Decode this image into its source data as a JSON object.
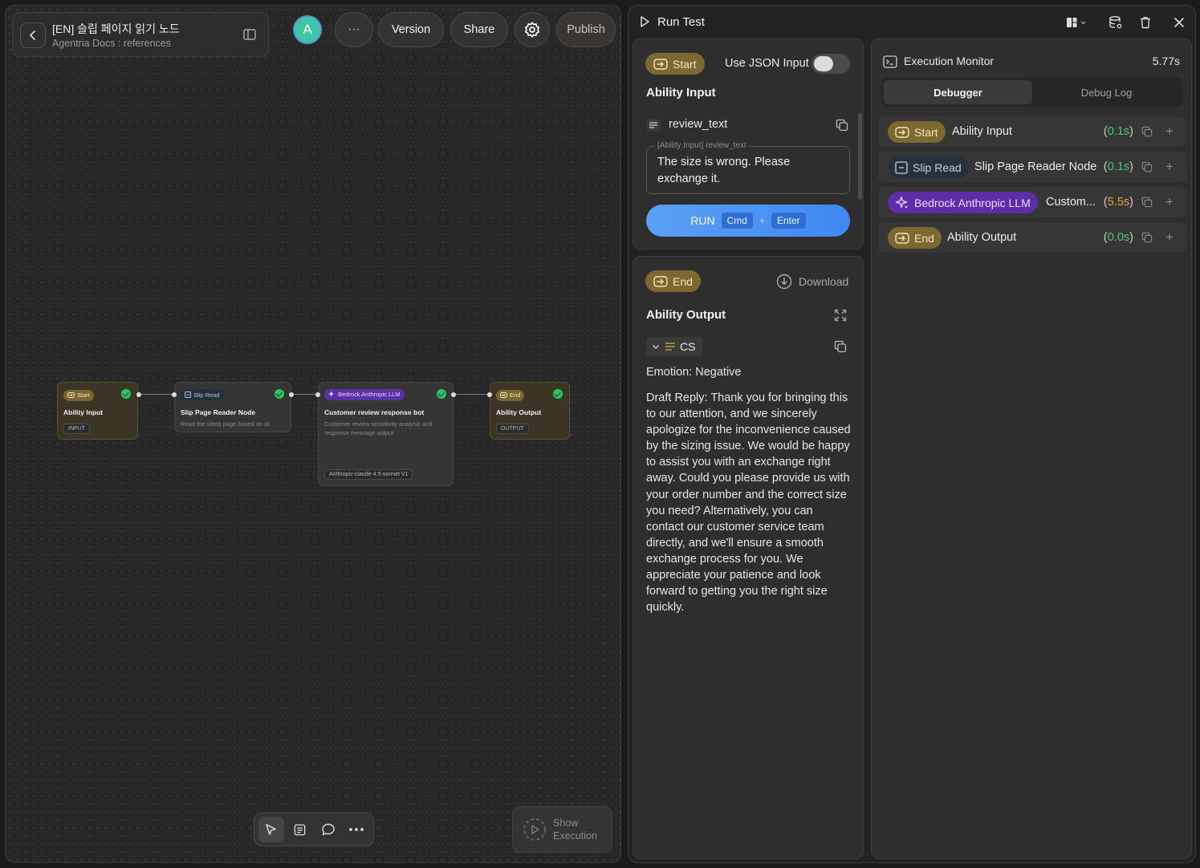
{
  "header": {
    "doc_title": "[EN] 슬립 페이지 읽기 노드",
    "doc_subtitle": "Agentria Docs : references",
    "avatar_letter": "A",
    "more_label": "···",
    "version_label": "Version",
    "share_label": "Share",
    "publish_label": "Publish"
  },
  "canvas": {
    "nodes": [
      {
        "badge": "Start",
        "title": "Ability Input",
        "tag": "INPUT"
      },
      {
        "badge": "Slip Read",
        "title": "Slip Page Reader Node",
        "desc": "Read the sleep page based on id"
      },
      {
        "badge": "Bedrock Anthropic LLM",
        "title": "Customer review response bot",
        "desc": "Customer review sensitivity analysis and response message output",
        "tag": "Anthropic-claude-4.5-sonnet V1"
      },
      {
        "badge": "End",
        "title": "Ability Output",
        "tag": "OUTPUT"
      }
    ],
    "show_execution_label": "Show Execution"
  },
  "run_test": {
    "title": "Run Test",
    "input": {
      "start_badge": "Start",
      "json_toggle_label": "Use JSON Input",
      "section_title": "Ability Input",
      "field_name": "review_text",
      "field_legend": "[Ability Input] review_text",
      "field_value": "The size is wrong. Please exchange it.",
      "run_label": "RUN",
      "kbd_cmd": "Cmd",
      "kbd_plus": "+",
      "kbd_enter": "Enter"
    },
    "output": {
      "end_badge": "End",
      "download_label": "Download",
      "section_title": "Ability Output",
      "chip_label": "CS",
      "emotion": "Emotion: Negative",
      "draft_reply": "Draft Reply: Thank you for bringing this to our attention, and we sincerely apologize for the inconvenience caused by the sizing issue. We would be happy to assist you with an exchange right away. Could you please provide us with your order number and the correct size you need? Alternatively, you can contact our customer service team directly, and we'll ensure a smooth exchange process for you. We appreciate your patience and look forward to getting you the right size quickly."
    },
    "monitor": {
      "title": "Execution Monitor",
      "total_time": "5.77s",
      "tabs": [
        "Debugger",
        "Debug Log"
      ],
      "rows": [
        {
          "badge": "Start",
          "name": "Ability Input",
          "time_open": "(",
          "time": "0.1s",
          "time_close": ")"
        },
        {
          "badge": "Slip Read",
          "name": "Slip Page Reader Node",
          "time_open": "(",
          "time": "0.1s",
          "time_close": ")"
        },
        {
          "badge": "Bedrock Anthropic LLM",
          "name": "Custom...",
          "time_open": "(",
          "time": "5.5s",
          "time_close": ")"
        },
        {
          "badge": "End",
          "name": "Ability Output",
          "time_open": "(",
          "time": "0.0s",
          "time_close": ")"
        }
      ]
    }
  },
  "colors": {
    "accent_blue": "#3f88f2",
    "start_end_badge": "#7d6930",
    "llm_badge": "#5d2ea8",
    "success_green": "#46c97b",
    "slow_amber": "#e4a63c"
  }
}
